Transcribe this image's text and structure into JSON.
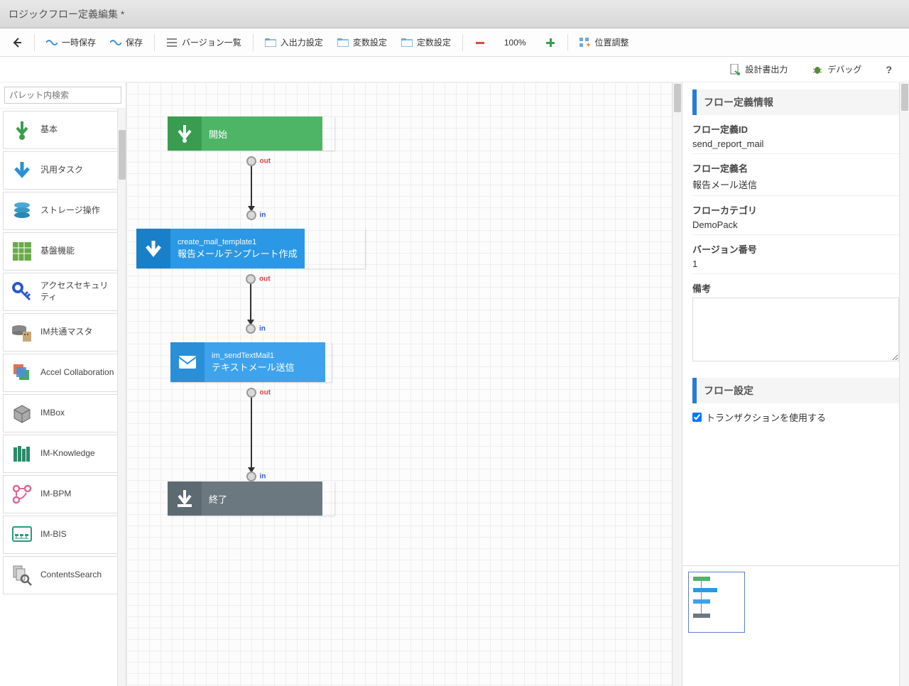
{
  "title": "ロジックフロー定義編集 *",
  "toolbar": {
    "temp_save": "一時保存",
    "save": "保存",
    "version_list": "バージョン一覧",
    "io_settings": "入出力設定",
    "var_settings": "変数設定",
    "const_settings": "定数設定",
    "zoom": "100%",
    "align": "位置調整"
  },
  "subtoolbar": {
    "design_output": "設計書出力",
    "debug": "デバッグ",
    "help": "?"
  },
  "palette": {
    "search_placeholder": "パレット内検索",
    "items": [
      "基本",
      "汎用タスク",
      "ストレージ操作",
      "基盤機能",
      "アクセスセキュリティ",
      "IM共通マスタ",
      "Accel Collaboration",
      "IMBox",
      "IM-Knowledge",
      "IM-BPM",
      "IM-BIS",
      "ContentsSearch"
    ]
  },
  "flow": {
    "nodes": {
      "start": {
        "label": "開始"
      },
      "task1": {
        "id": "create_mail_template1",
        "label": "報告メールテンプレート作成"
      },
      "task2": {
        "id": "im_sendTextMail1",
        "label": "テキストメール送信"
      },
      "end": {
        "label": "終了"
      }
    },
    "ports": {
      "out": "out",
      "in": "in"
    }
  },
  "rightpanel": {
    "section_flowdef": "フロー定義情報",
    "flowdef_id_label": "フロー定義ID",
    "flowdef_id": "send_report_mail",
    "flowdef_name_label": "フロー定義名",
    "flowdef_name": "報告メール送信",
    "category_label": "フローカテゴリ",
    "category": "DemoPack",
    "version_label": "バージョン番号",
    "version": "1",
    "remarks_label": "備考",
    "section_flowset": "フロー設定",
    "transaction_label": "トランザクションを使用する"
  }
}
